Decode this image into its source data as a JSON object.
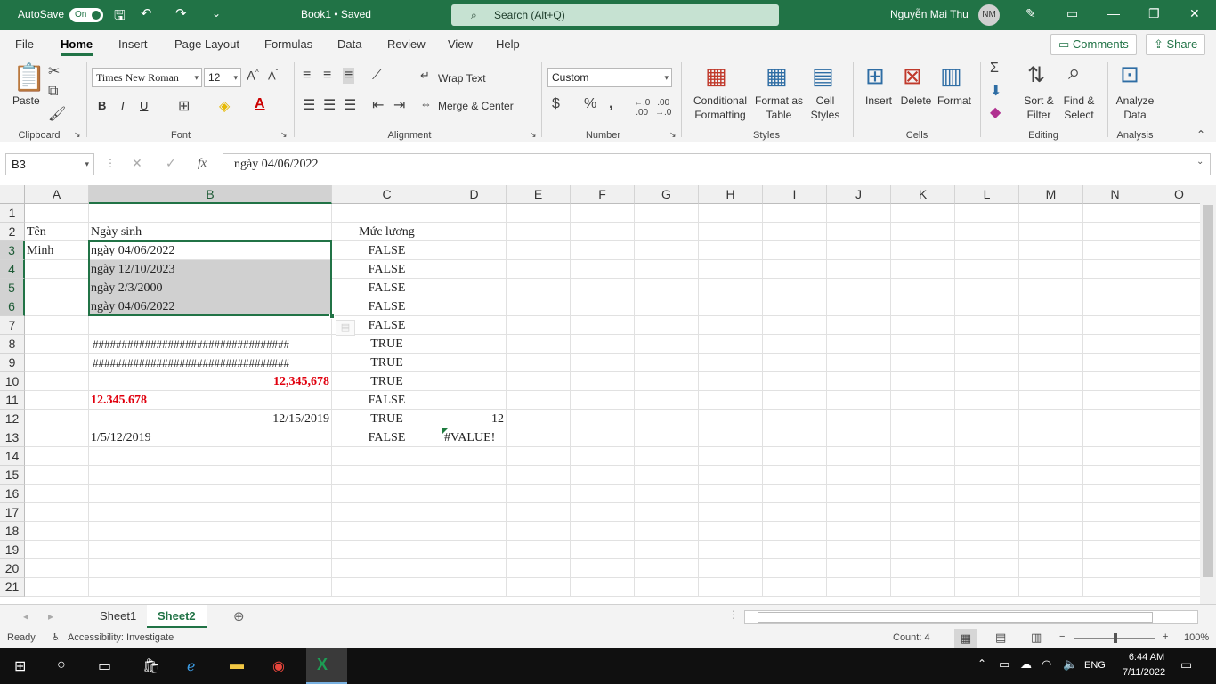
{
  "titlebar": {
    "autosave_label": "AutoSave",
    "autosave_state": "On",
    "doc_title": "Book1 • Saved",
    "search_placeholder": "Search (Alt+Q)",
    "user_name": "Nguyễn Mai Thu",
    "user_initials": "NM"
  },
  "menu": {
    "items": [
      "File",
      "Home",
      "Insert",
      "Page Layout",
      "Formulas",
      "Data",
      "Review",
      "View",
      "Help"
    ],
    "active": "Home",
    "comments_label": "Comments",
    "share_label": "Share"
  },
  "ribbon": {
    "paste_label": "Paste",
    "font_name": "Times New Roman",
    "font_size": "12",
    "bold": "B",
    "italic": "I",
    "underline": "U",
    "wrap_text": "Wrap Text",
    "merge_center": "Merge & Center",
    "number_format": "Custom",
    "conditional_formatting_1": "Conditional",
    "conditional_formatting_2": "Formatting",
    "format_table_1": "Format as",
    "format_table_2": "Table",
    "cell_styles_1": "Cell",
    "cell_styles_2": "Styles",
    "insert": "Insert",
    "delete": "Delete",
    "format": "Format",
    "sort_filter_1": "Sort &",
    "sort_filter_2": "Filter",
    "find_select_1": "Find &",
    "find_select_2": "Select",
    "analyze_1": "Analyze",
    "analyze_2": "Data",
    "groups": {
      "clipboard": "Clipboard",
      "font": "Font",
      "alignment": "Alignment",
      "number": "Number",
      "styles": "Styles",
      "cells": "Cells",
      "editing": "Editing",
      "analysis": "Analysis"
    }
  },
  "formula_bar": {
    "name_box": "B3",
    "fx": "fx",
    "content": "ngày 04/06/2022"
  },
  "grid": {
    "columns": [
      "A",
      "B",
      "C",
      "D",
      "E",
      "F",
      "G",
      "H",
      "I",
      "J",
      "K",
      "L",
      "M",
      "N",
      "O"
    ],
    "rows": [
      "1",
      "2",
      "3",
      "4",
      "5",
      "6",
      "7",
      "8",
      "9",
      "10",
      "11",
      "12",
      "13",
      "14",
      "15",
      "16",
      "17",
      "18",
      "19",
      "20",
      "21"
    ],
    "cells": {
      "A2": "Tên",
      "B2": "Ngày sinh",
      "C2": "Mức lương",
      "A3": "Minh",
      "B3": "ngày 04/06/2022",
      "B4": "ngày 12/10/2023",
      "B5": " ngày 2/3/2000",
      "B6": "ngày 04/06/2022",
      "B8": "##################################",
      "B9": "##################################",
      "B10": "12,345,678",
      "B11": "12.345.678",
      "B12": "12/15/2019",
      "B13": "1/5/12/2019",
      "C3": "FALSE",
      "C4": "FALSE",
      "C5": "FALSE",
      "C6": "FALSE",
      "C7": "FALSE",
      "C8": "TRUE",
      "C9": "TRUE",
      "C10": "TRUE",
      "C11": "FALSE",
      "C12": "TRUE",
      "C13": "FALSE",
      "D12": "12",
      "D13": "#VALUE!"
    },
    "red_color": "#e0000e",
    "selection_color": "#217346"
  },
  "sheets": {
    "tabs": [
      "Sheet1",
      "Sheet2"
    ],
    "active": "Sheet2"
  },
  "status": {
    "ready": "Ready",
    "accessibility": "Accessibility: Investigate",
    "count": "Count: 4",
    "zoom": "100%"
  },
  "taskbar": {
    "language": "ENG",
    "time": "6:44 AM",
    "date": "7/11/2022"
  }
}
